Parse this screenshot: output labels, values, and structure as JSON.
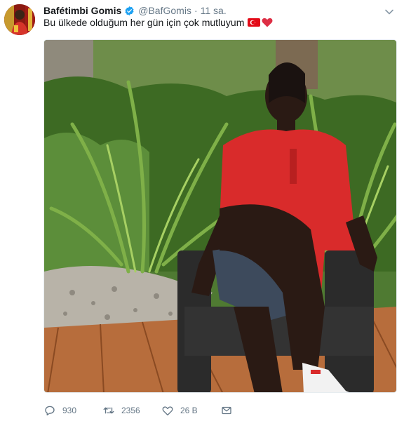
{
  "tweet": {
    "author_name": "Bafétimbi Gomis",
    "author_handle": "@BafGomis",
    "separator": "·",
    "timestamp": "11 sa.",
    "text": "Bu ülkede olduğum her gün için çok mutluyum",
    "emojis": [
      "turkey-flag",
      "red-heart"
    ],
    "verified": true
  },
  "actions": {
    "reply_count": "930",
    "retweet_count": "2356",
    "like_count": "26 B"
  },
  "colors": {
    "text": "#14171a",
    "secondary": "#657786",
    "verified_blue": "#1da1f2",
    "shirt_red": "#d92b2b"
  },
  "icons": [
    "verified-badge-icon",
    "chevron-down-icon",
    "reply-icon",
    "retweet-icon",
    "like-icon",
    "direct-message-icon"
  ]
}
